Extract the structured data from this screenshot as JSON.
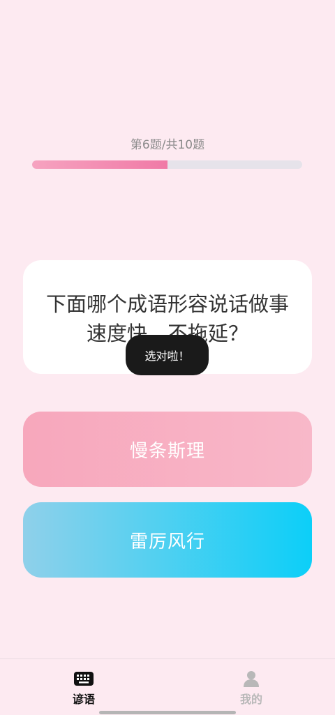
{
  "progress": {
    "label": "第6题/共10题",
    "current": 6,
    "total": 10,
    "fraction": 0.5
  },
  "question": {
    "text": "下面哪个成语形容说话做事速度快，不拖延？"
  },
  "toast": {
    "text": "选对啦！"
  },
  "options": [
    {
      "label": "慢条斯理"
    },
    {
      "label": "雷厉风行"
    }
  ],
  "tabbar": {
    "items": [
      {
        "label": "谚语",
        "icon": "keyboard-icon",
        "active": true
      },
      {
        "label": "我的",
        "icon": "user-icon",
        "active": false
      }
    ]
  },
  "colors": {
    "background": "#fdeaf1",
    "progress_fill": "#f07aa6",
    "progress_track": "#e6e3ea",
    "option_pink": "#f7a7bc",
    "option_blue": "#0ccff8",
    "toast_bg": "#1a1a1a"
  }
}
